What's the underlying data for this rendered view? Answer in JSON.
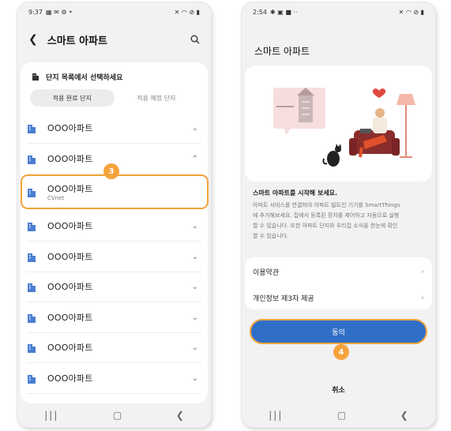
{
  "left": {
    "status": {
      "time": "9:37",
      "left_icons": "▦ ✉ ⚙ •",
      "right_icons": "✕ ◠ ⊘ ▮"
    },
    "header": {
      "title": "스마트 아파트"
    },
    "list_header": "단지 목록에서 선택하세요",
    "tabs": [
      "적용 완료 단지",
      "적용 예정 단지"
    ],
    "rows": [
      {
        "name": "OOO아파트",
        "chevron": "down"
      },
      {
        "name": "OOO아파트",
        "chevron": "up"
      },
      {
        "name": "OOO아파트",
        "sub": "CVnet",
        "selected": true
      },
      {
        "name": "OOO아파트",
        "chevron": "down"
      },
      {
        "name": "OOO아파트",
        "chevron": "down"
      },
      {
        "name": "OOO아파트",
        "chevron": "down"
      },
      {
        "name": "OOO아파트",
        "chevron": "down"
      },
      {
        "name": "OOO아파트",
        "chevron": "down"
      },
      {
        "name": "OOO아파트",
        "chevron": "down"
      }
    ],
    "badge": "3"
  },
  "right": {
    "status": {
      "time": "2:54",
      "left_icons": "✱ ▣ ■ ··",
      "right_icons": "✕ ◠ ⊘ ▮"
    },
    "header": {
      "title": "스마트 아파트"
    },
    "intro_title": "스마트 아파트를 시작해 보세요.",
    "intro_lines": [
      "아파트 서비스를 연결하여 아파트 빌트인 기기를 SmartThings",
      "에 추가해보세요. 집에서 등록된 장치를 제어하고 자동으로 실행",
      "할 수 있습니다. 또한 아파트 단지와 우리집 소식을 한눈에 확인",
      "할 수 있습니다."
    ],
    "menu": [
      "이용약관",
      "개인정보 제3자 제공"
    ],
    "agree_label": "동의",
    "cancel_label": "취소",
    "badge": "4"
  },
  "colors": {
    "accent_orange": "#f2a43a",
    "button_blue": "#2f6fc7",
    "building_icon": "#4a7fd1"
  },
  "nav_icons": [
    "recent-apps-icon",
    "home-icon",
    "back-icon"
  ]
}
